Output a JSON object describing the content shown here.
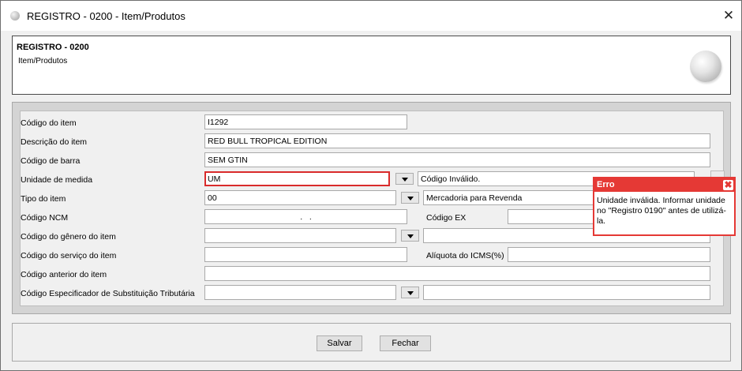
{
  "window": {
    "title": "REGISTRO - 0200 - Item/Produtos",
    "close_glyph": "✕"
  },
  "header": {
    "title": "REGISTRO - 0200",
    "subtitle": "Item/Produtos",
    "logo_icon": "globe-logo-icon"
  },
  "form": {
    "codigo_item": {
      "label": "Código do item",
      "value": "I1292"
    },
    "descricao_item": {
      "label": "Descrição do item",
      "value": "RED BULL TROPICAL EDITION"
    },
    "codigo_barra": {
      "label": "Código de barra",
      "value": "SEM GTIN"
    },
    "unidade_medida": {
      "label": "Unidade de medida",
      "value": "UM",
      "description": "Código Inválido."
    },
    "tipo_item": {
      "label": "Tipo do item",
      "value": "00",
      "description": "Mercadoria para Revenda"
    },
    "codigo_ncm": {
      "label": "Código NCM",
      "value": ".   .",
      "ex_label": "Código EX",
      "ex_value": ""
    },
    "codigo_genero": {
      "label": "Código do gênero do item",
      "value": "",
      "description": ""
    },
    "codigo_servico": {
      "label": "Código do serviço do item",
      "value": "",
      "icms_label": "Alíquota do ICMS(%)",
      "icms_value": ""
    },
    "codigo_anterior": {
      "label": "Código anterior do item",
      "value": ""
    },
    "codigo_cest": {
      "label": "Código Especificador de Substituição Tributária",
      "value": "",
      "description": ""
    }
  },
  "buttons": {
    "save": "Salvar",
    "close": "Fechar"
  },
  "error": {
    "title": "Erro",
    "close_glyph": "✖",
    "message": "Unidade inválida. Informar unidade no \"Registro 0190\" antes de utilizá-la."
  },
  "colors": {
    "error_red": "#e53935",
    "invalid_border": "#d92b2b"
  }
}
